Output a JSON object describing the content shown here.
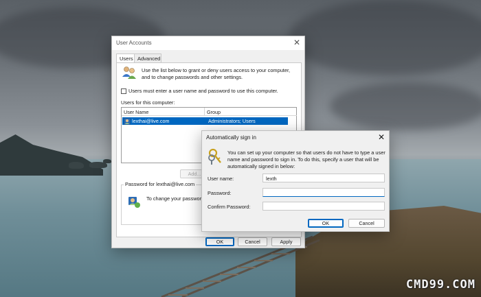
{
  "watermark": "CMD99.COM",
  "user_accounts": {
    "title": "User Accounts",
    "close_glyph": "✕",
    "tabs": [
      "Users",
      "Advanced"
    ],
    "intro_line1": "Use the list below to grant or deny users access to your computer,",
    "intro_line2": "and to change passwords and other settings.",
    "checkbox_label": "Users must enter a user name and password to use this computer.",
    "checkbox_checked": false,
    "users_label": "Users for this computer:",
    "columns": [
      "User Name",
      "Group"
    ],
    "rows": [
      {
        "name": "lexthai@live.com",
        "group": "Administrators; Users",
        "selected": true
      }
    ],
    "add_button": "Add...",
    "password_group_label": "Password for lexthai@live.com",
    "password_text": "To change your password",
    "ok_button": "OK",
    "cancel_button": "Cancel",
    "apply_button": "Apply"
  },
  "auto_sign_in": {
    "title": "Automatically sign in",
    "close_glyph": "✕",
    "description_line1": "You can set up your computer so that users do not have to type a user",
    "description_line2": "name and password to sign in. To do this, specify a user that will be",
    "description_line3": "automatically signed in below:",
    "username_label": "User name:",
    "username_value": "lexth",
    "password_label": "Password:",
    "password_value": "",
    "confirm_label": "Confirm Password:",
    "confirm_value": "",
    "ok_button": "OK",
    "cancel_button": "Cancel"
  },
  "colors": {
    "accent": "#0067c0",
    "selection": "#0067c0",
    "window_bg": "#f0f0f0"
  },
  "icons": {
    "users_icon": "users-icon",
    "keys_icon": "keys-icon",
    "user_password_icon": "user-password-icon",
    "user_row_icon": "user-icon"
  }
}
